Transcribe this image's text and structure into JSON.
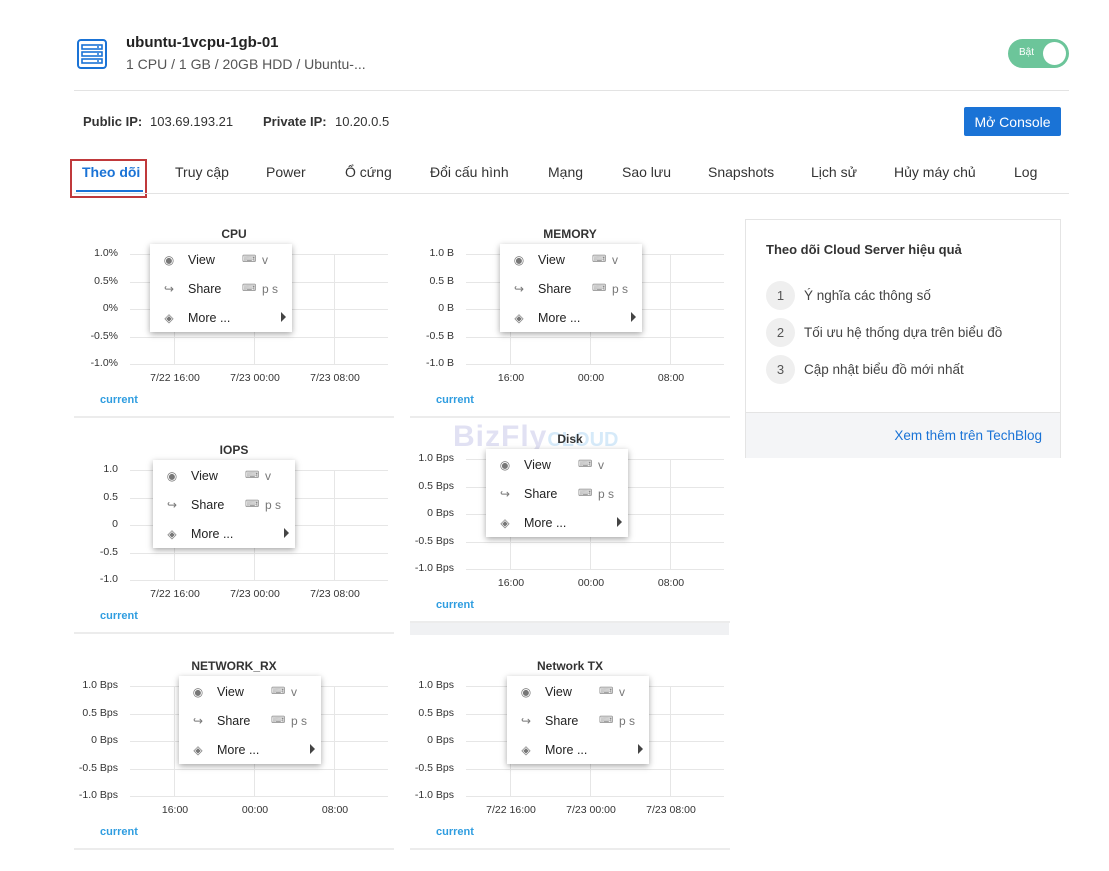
{
  "server": {
    "name": "ubuntu-1vcpu-1gb-01",
    "spec": "1 CPU / 1 GB / 20GB HDD / Ubuntu-...",
    "toggle_label": "Bật"
  },
  "ips": {
    "public_label": "Public IP:",
    "public_value": "103.69.193.21",
    "private_label": "Private IP:",
    "private_value": "10.20.0.5"
  },
  "console_label": "Mở Console",
  "tabs": [
    "Theo dõi",
    "Truy cập",
    "Power",
    "Ổ cứng",
    "Đổi cấu hình",
    "Mạng",
    "Sao lưu",
    "Snapshots",
    "Lịch sử",
    "Hủy máy chủ",
    "Log"
  ],
  "context_menu": {
    "view": "View",
    "view_key": "v",
    "share": "Share",
    "share_key": "p s",
    "more": "More ..."
  },
  "current_label": "current",
  "watermark": {
    "main": "BizFly",
    "sub": "CLOUD"
  },
  "charts": [
    {
      "title": "CPU",
      "y_ticks": [
        "1.0%",
        "0.5%",
        "0%",
        "-0.5%",
        "-1.0%"
      ],
      "x_ticks": [
        "7/22 16:00",
        "7/23 00:00",
        "7/23 08:00"
      ]
    },
    {
      "title": "MEMORY",
      "y_ticks": [
        "1.0 B",
        "0.5 B",
        "0 B",
        "-0.5 B",
        "-1.0 B"
      ],
      "x_ticks": [
        "16:00",
        "00:00",
        "08:00"
      ]
    },
    {
      "title": "IOPS",
      "y_ticks": [
        "1.0",
        "0.5",
        "0",
        "-0.5",
        "-1.0"
      ],
      "x_ticks": [
        "7/22 16:00",
        "7/23 00:00",
        "7/23 08:00"
      ]
    },
    {
      "title": "Disk",
      "y_ticks": [
        "1.0 Bps",
        "0.5 Bps",
        "0 Bps",
        "-0.5 Bps",
        "-1.0 Bps"
      ],
      "x_ticks": [
        "16:00",
        "00:00",
        "08:00"
      ]
    },
    {
      "title": "NETWORK_RX",
      "y_ticks": [
        "1.0 Bps",
        "0.5 Bps",
        "0 Bps",
        "-0.5 Bps",
        "-1.0 Bps"
      ],
      "x_ticks": [
        "16:00",
        "00:00",
        "08:00"
      ]
    },
    {
      "title": "Network TX",
      "y_ticks": [
        "1.0 Bps",
        "0.5 Bps",
        "0 Bps",
        "-0.5 Bps",
        "-1.0 Bps"
      ],
      "x_ticks": [
        "7/22 16:00",
        "7/23 00:00",
        "7/23 08:00"
      ]
    }
  ],
  "panel": {
    "title": "Theo dõi Cloud Server hiệu quả",
    "steps": [
      {
        "num": "1",
        "text": "Ý nghĩa các thông số"
      },
      {
        "num": "2",
        "text": "Tối ưu hệ thống dựa trên biểu đồ"
      },
      {
        "num": "3",
        "text": "Cập nhật biểu đồ mới nhất"
      }
    ],
    "link": "Xem thêm trên TechBlog"
  }
}
